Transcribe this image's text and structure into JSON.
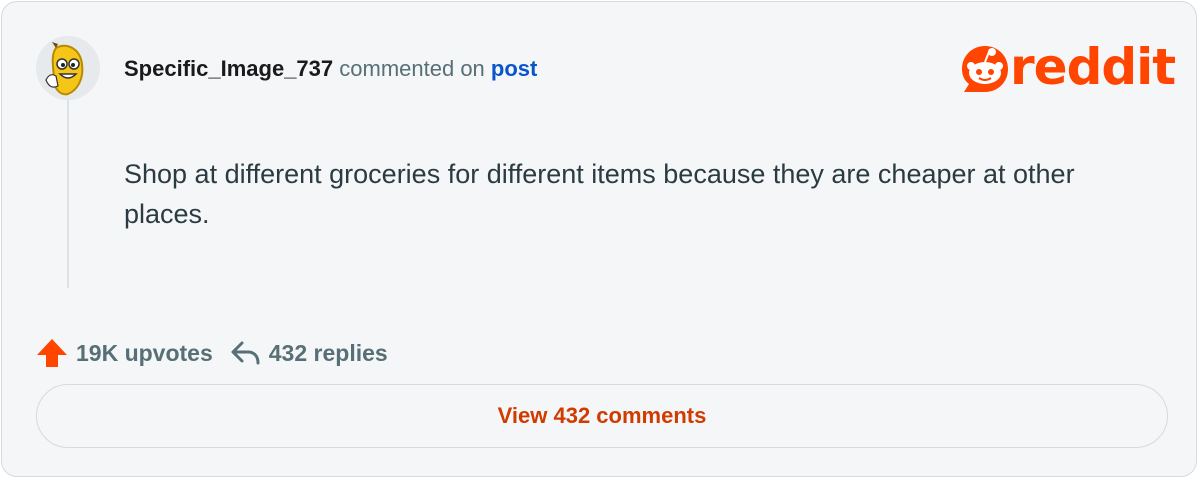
{
  "comment": {
    "username": "Specific_Image_737",
    "action_text": "commented on",
    "post_link_label": "post",
    "body": "Shop at different groceries for different items because they are cheaper at other places.",
    "avatar_icon": "banana-avatar-icon"
  },
  "brand": {
    "logo_text": "reddit",
    "logo_icon": "reddit-snoo-icon",
    "accent_color": "#ff4500"
  },
  "stats": {
    "upvotes_label": "19K upvotes",
    "upvote_icon": "upvote-arrow-icon",
    "upvote_color": "#ff4500",
    "replies_label": "432 replies",
    "reply_icon": "reply-arrow-icon"
  },
  "footer": {
    "view_comments_label": "View 432 comments",
    "view_comments_color": "#d03b00"
  },
  "colors": {
    "card_background": "#f5f6f8",
    "link_blue": "#0a55c8",
    "muted_text": "#576f76"
  }
}
